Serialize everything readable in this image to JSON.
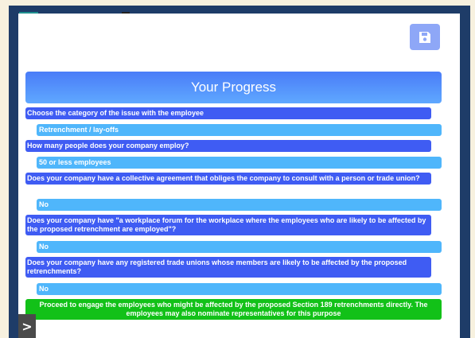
{
  "toolbar": {
    "save_icon": "floppy-disk-icon"
  },
  "progress": {
    "title": "Your Progress"
  },
  "steps": [
    {
      "question": "Choose the category of the issue with the employee",
      "answer": "Retrenchment / lay-offs"
    },
    {
      "question": "How many people does your company employ?",
      "answer": "50 or less employees"
    },
    {
      "question": "Does your company have a collective agreement that obliges the company to consult with a person or trade union?",
      "answer": "No"
    },
    {
      "question": "Does your company have \"a workplace forum for the workplace where the employees who are likely to be affected by the proposed retrenchment are employed\"?",
      "answer": "No"
    },
    {
      "question": "Does your company have any registered trade unions whose members are likely to be affected by the proposed retrenchments?",
      "answer": "No"
    }
  ],
  "result": "Proceed to engage the employees who might be affected by the proposed Section 189 retrenchments directly. The employees may also nominate representatives for this purpose",
  "sidebar_toggle": {
    "label": ">"
  },
  "colors": {
    "frame": "#1e3c68",
    "question": "#3f5cf3",
    "answer": "#4fb6fb",
    "result": "#12c118",
    "save_button": "#8ea7f7"
  }
}
